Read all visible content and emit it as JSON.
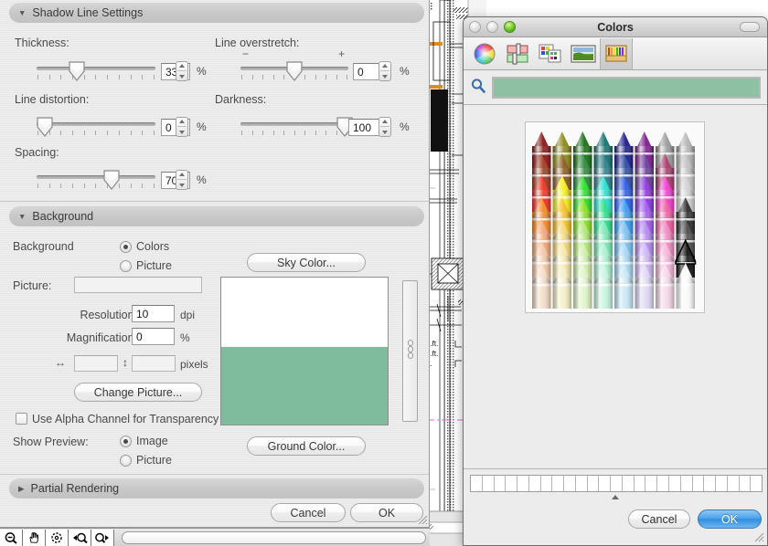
{
  "background_app": {
    "name": "cad-drawing-canvas",
    "toolbar_icons": [
      "zoom-out-icon",
      "pan-hand-icon",
      "fit-to-window-icon",
      "zoom-previous-icon",
      "zoom-next-icon"
    ],
    "annotations": [
      "q.ft.",
      "q.ft.",
      "ft."
    ]
  },
  "settings_panel": {
    "sections": [
      {
        "title": "Shadow Line Settings",
        "expanded": true,
        "disclosure": "triangle-down-icon"
      },
      {
        "title": "Background",
        "expanded": true,
        "disclosure": "triangle-down-icon"
      },
      {
        "title": "Partial Rendering",
        "expanded": false,
        "disclosure": "triangle-right-icon"
      }
    ],
    "sliders": [
      {
        "label": "Thickness:",
        "value": "33",
        "unit": "%",
        "fill": 0.33,
        "marks": false
      },
      {
        "label": "Line overstretch:",
        "value": "0",
        "unit": "%",
        "fill": 0.5,
        "marks": true,
        "minus": "−",
        "plus": "+"
      },
      {
        "label": "Line distortion:",
        "value": "0",
        "unit": "%",
        "fill": 0.03,
        "marks": false
      },
      {
        "label": "Darkness:",
        "value": "100",
        "unit": "%",
        "fill": 0.97,
        "marks": false
      },
      {
        "label": "Spacing:",
        "value": "70",
        "unit": "%",
        "fill": 0.63,
        "marks": false
      }
    ],
    "background_group": {
      "label": "Background",
      "radios": [
        {
          "label": "Colors",
          "selected": true
        },
        {
          "label": "Picture",
          "selected": false
        }
      ],
      "sky_button": "Sky Color...",
      "ground_button": "Ground Color...",
      "picture_label": "Picture:",
      "picture_value": "",
      "resolution_label": "Resolution:",
      "resolution_value": "10",
      "resolution_unit": "dpi",
      "magnification_label": "Magnification:",
      "magnification_value": "0",
      "magnification_unit": "%",
      "width_icon": "horizontal-arrows-icon",
      "width_value": "",
      "height_icon": "vertical-arrows-icon",
      "height_value": "",
      "pixels_unit": "pixels",
      "change_picture_button": "Change Picture...",
      "alpha_checkbox_label": "Use Alpha Channel for Transparency",
      "alpha_checked": false,
      "show_preview_label": "Show Preview:",
      "preview_radios": [
        {
          "label": "Image",
          "selected": true
        },
        {
          "label": "Picture",
          "selected": false
        }
      ],
      "preview_sky_color": "#ffffff",
      "preview_ground_color": "#7fbc9d"
    },
    "footer": {
      "cancel": "Cancel",
      "ok": "OK"
    }
  },
  "colors_window": {
    "title": "Colors",
    "traffic_lights": [
      "close-button",
      "minimize-button",
      "zoom-button"
    ],
    "toolbar_pill": "toolbar-toggle-pill",
    "tabs": [
      {
        "name": "color-wheel-icon",
        "selected": false
      },
      {
        "name": "color-sliders-icon",
        "selected": false
      },
      {
        "name": "color-palettes-icon",
        "selected": false
      },
      {
        "name": "image-palettes-icon",
        "selected": false
      },
      {
        "name": "crayons-icon",
        "selected": true
      }
    ],
    "search_icon": "magnifier-icon",
    "current_color": "#8ec0a4",
    "swatch_count": 25,
    "buttons": {
      "cancel": "Cancel",
      "ok": "OK"
    },
    "crayon_rows": [
      [
        "#8a1414",
        "#8a8a14",
        "#147014",
        "#147070",
        "#1a1a8c",
        "#7a1a8c",
        "#9a9a9a",
        "#b4b4b4"
      ],
      [
        "#a03a1e",
        "#8a5a1e",
        "#2c8a3c",
        "#2c7e8a",
        "#2c4aa0",
        "#6a3a9a",
        "#a63a6a",
        "#c2c2c2"
      ],
      [
        "#f03020",
        "#f5f01a",
        "#26e024",
        "#24e0d0",
        "#2a5ce8",
        "#8a34e0",
        "#f03ad0",
        "#d0d0d0"
      ],
      [
        "#f58a24",
        "#f5c024",
        "#8ae024",
        "#24e08a",
        "#3a9cf0",
        "#a05cf0",
        "#f05ca0",
        "#2a2a2a"
      ],
      [
        "#f5a87a",
        "#f5d87a",
        "#b4e87a",
        "#7ae8b4",
        "#7ac0f0",
        "#b48af0",
        "#f08ac0",
        "#4a4a4a"
      ],
      [
        "#f5c8a8",
        "#f5e8a8",
        "#d0f0a8",
        "#a8f0d0",
        "#a8d8f5",
        "#d0b4f5",
        "#f5b4d8",
        "#111111"
      ],
      [
        "#f5ddc8",
        "#f5f0c8",
        "#e0f5c8",
        "#c8f5e0",
        "#c8e8f5",
        "#e0d8f5",
        "#f5d8e8",
        "#fafafa"
      ]
    ],
    "selected_crayon": {
      "row": 5,
      "col": 7
    }
  }
}
